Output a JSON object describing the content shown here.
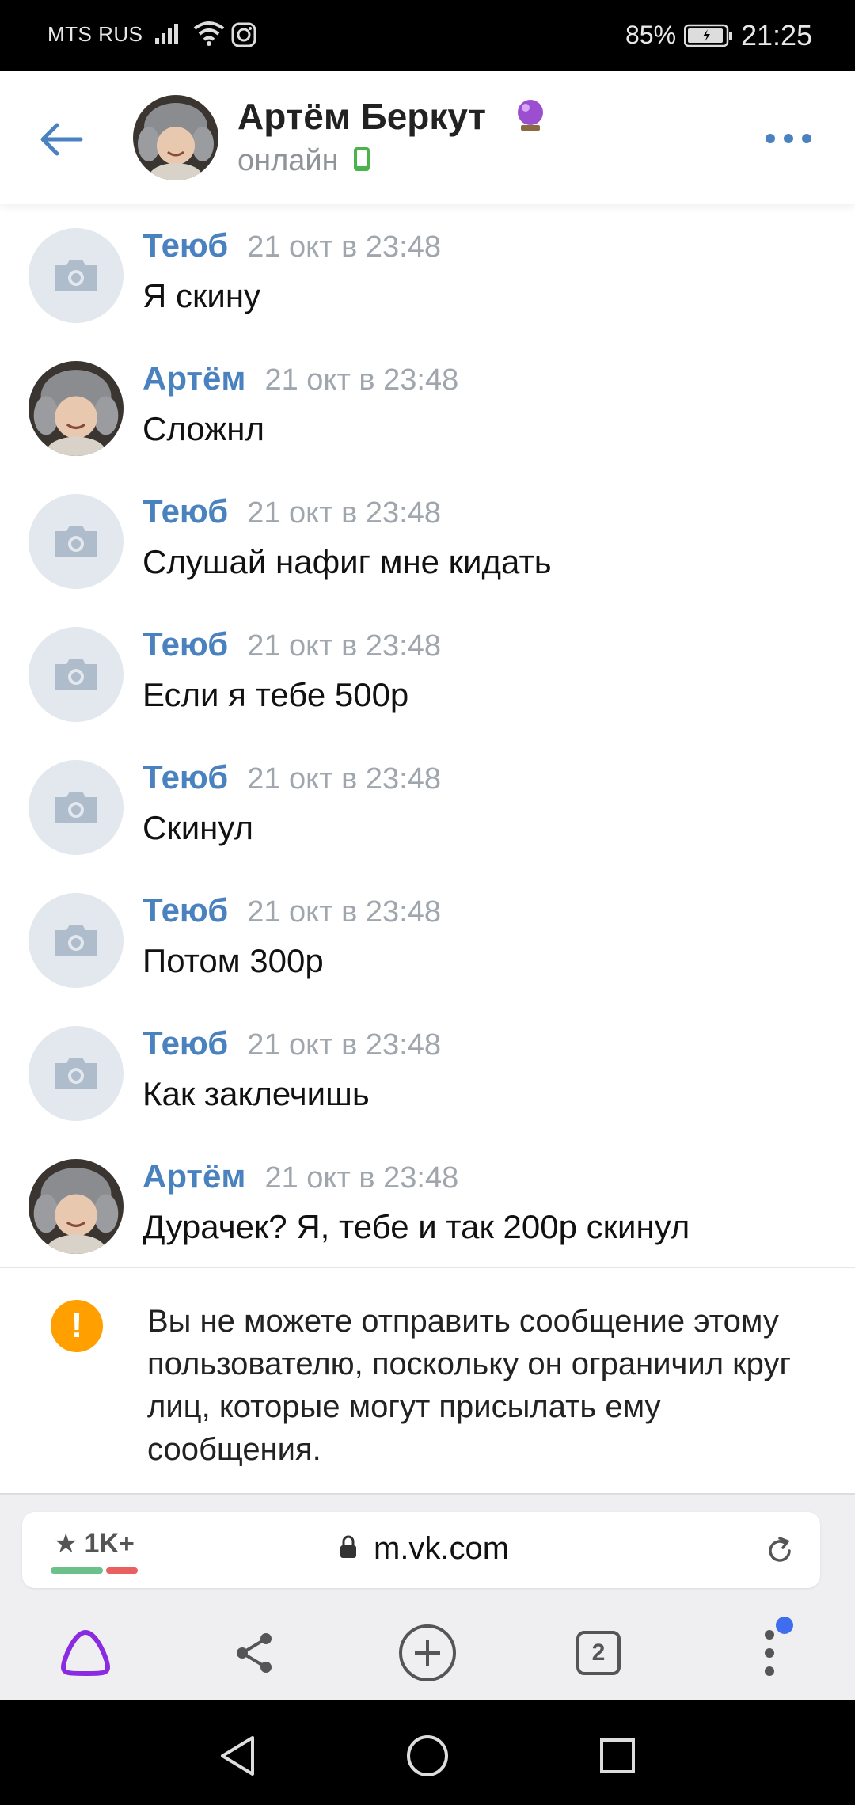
{
  "status_bar": {
    "carrier": "MTS RUS",
    "battery_percent": "85%",
    "time": "21:25"
  },
  "header": {
    "contact_name": "Артём Беркут",
    "status": "онлайн"
  },
  "messages": [
    {
      "author": "Теюб",
      "time": "21 окт в 23:48",
      "text": "Я скину",
      "avatar": "camera-placeholder"
    },
    {
      "author": "Артём",
      "time": "21 окт в 23:48",
      "text": "Сложнл",
      "avatar": "photo"
    },
    {
      "author": "Теюб",
      "time": "21 окт в 23:48",
      "text": "Слушай нафиг мне кидать",
      "avatar": "camera-placeholder"
    },
    {
      "author": "Теюб",
      "time": "21 окт в 23:48",
      "text": "Если я тебе 500р",
      "avatar": "camera-placeholder"
    },
    {
      "author": "Теюб",
      "time": "21 окт в 23:48",
      "text": "Скинул",
      "avatar": "camera-placeholder"
    },
    {
      "author": "Теюб",
      "time": "21 окт в 23:48",
      "text": "Потом 300р",
      "avatar": "camera-placeholder"
    },
    {
      "author": "Теюб",
      "time": "21 окт в 23:48",
      "text": "Как заклечишь",
      "avatar": "camera-placeholder"
    },
    {
      "author": "Артём",
      "time": "21 окт в 23:48",
      "text": "Дурачек? Я, тебе и так 200р скинул",
      "avatar": "photo"
    }
  ],
  "notice": {
    "icon": "warning-icon",
    "text": "Вы не можете отправить сообщение этому пользователю, поскольку он ограничил круг лиц, которые могут присылать ему сообщения."
  },
  "browser": {
    "rating": "1K+",
    "url": "m.vk.com",
    "tab_count": "2"
  },
  "colors": {
    "accent": "#4a82c0",
    "warning": "#ffa000",
    "alice": "#8a2be2",
    "notif_dot": "#3f6df0"
  }
}
